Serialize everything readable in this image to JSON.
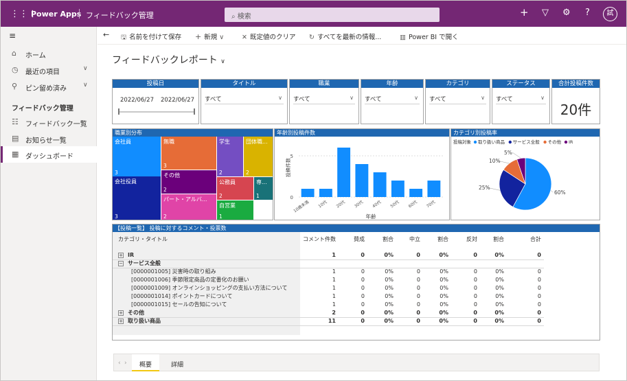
{
  "topbar": {
    "brand": "Power Apps",
    "app_name": "フィードバック管理",
    "search_placeholder": "検索",
    "avatar": "試"
  },
  "sidebar": {
    "items": [
      {
        "label": "ホーム",
        "icon": "home-icon"
      },
      {
        "label": "最近の項目",
        "icon": "clock-icon"
      },
      {
        "label": "ピン留め済み",
        "icon": "pin-icon"
      }
    ],
    "group_label": "フィードバック管理",
    "nav": [
      {
        "label": "フィードバック一覧",
        "icon": "list-icon"
      },
      {
        "label": "お知らせ一覧",
        "icon": "doc-icon"
      },
      {
        "label": "ダッシュボード",
        "icon": "dashboard-icon"
      }
    ]
  },
  "commands": {
    "save_as": "名前を付けて保存",
    "new": "新規",
    "clear_default": "既定値のクリア",
    "refresh_all": "すべてを最新の情報...",
    "open_powerbi": "Power BI で開く"
  },
  "page_title": "フィードバックレポート",
  "filters": {
    "date": {
      "header": "投稿日",
      "from": "2022/06/27",
      "to": "2022/06/27"
    },
    "title": {
      "header": "タイトル",
      "value": "すべて"
    },
    "occupation": {
      "header": "職業",
      "value": "すべて"
    },
    "age": {
      "header": "年齢",
      "value": "すべて"
    },
    "category": {
      "header": "カテゴリ",
      "value": "すべて"
    },
    "status": {
      "header": "ステータス",
      "value": "すべて"
    },
    "total": {
      "header": "合計投稿件数",
      "value": "20件"
    }
  },
  "chart_data": [
    {
      "type": "treemap",
      "title": "職業別分布",
      "items": [
        {
          "label": "会社員",
          "value": 3,
          "color": "#118dff"
        },
        {
          "label": "会社役員",
          "value": 3,
          "color": "#12239e"
        },
        {
          "label": "無職",
          "value": 3,
          "color": "#e66c37"
        },
        {
          "label": "その他",
          "value": 2,
          "color": "#6b007b"
        },
        {
          "label": "パート・アルバ...",
          "value": 2,
          "color": "#e044a7"
        },
        {
          "label": "学生",
          "value": 2,
          "color": "#744ec2"
        },
        {
          "label": "団体職...",
          "value": 2,
          "color": "#d9b300"
        },
        {
          "label": "公務員",
          "value": 2,
          "color": "#d64550"
        },
        {
          "label": "専...",
          "value": 1,
          "color": "#197278"
        },
        {
          "label": "自営業",
          "value": 1,
          "color": "#1aab40"
        }
      ]
    },
    {
      "type": "bar",
      "title": "年齢別投稿件数",
      "xlabel": "年齢",
      "ylabel": "投稿件数",
      "categories": [
        "10歳未満",
        "10代",
        "20代",
        "30代",
        "40代",
        "50代",
        "60代",
        "70代"
      ],
      "values": [
        1,
        1,
        6,
        4,
        3,
        2,
        1,
        2
      ],
      "yticks": [
        0,
        5
      ],
      "ylim": [
        0,
        6.5
      ],
      "color": "#118dff"
    },
    {
      "type": "pie",
      "title": "カテゴリ別投稿率",
      "legend_title": "投稿対象",
      "legend": [
        {
          "label": "取り扱い商品",
          "color": "#118dff"
        },
        {
          "label": "サービス全般",
          "color": "#12239e"
        },
        {
          "label": "その他",
          "color": "#e66c37"
        },
        {
          "label": "IR",
          "color": "#6b007b"
        }
      ],
      "values": [
        11,
        5,
        2,
        1
      ],
      "labels": [
        "60%",
        "25%",
        "10%",
        "5%"
      ]
    }
  ],
  "comment_table": {
    "title": "【投稿一覧】 投稿に対するコメント・投票数",
    "headers": [
      "カテゴリ・タイトル",
      "コメント件数",
      "賛成",
      "割合",
      "中立",
      "割合",
      "反対",
      "割合",
      "合計"
    ],
    "rows": [
      {
        "type": "group",
        "toggle": "+",
        "label": "IR",
        "vals": [
          "1",
          "0",
          "0%",
          "0",
          "0%",
          "0",
          "0%",
          "0"
        ]
      },
      {
        "type": "group",
        "toggle": "−",
        "label": "サービス全般",
        "vals": [
          "",
          "",
          "",
          "",
          "",
          "",
          "",
          ""
        ]
      },
      {
        "type": "item",
        "label": "[0000001005] 災害時の取り組み",
        "vals": [
          "1",
          "0",
          "0%",
          "0",
          "0%",
          "0",
          "0%",
          "0"
        ]
      },
      {
        "type": "item",
        "label": "[0000001006] 季節限定商品の定番化のお願い",
        "vals": [
          "1",
          "0",
          "0%",
          "0",
          "0%",
          "0",
          "0%",
          "0"
        ]
      },
      {
        "type": "item",
        "label": "[0000001009] オンラインショッピングの支払い方法について",
        "vals": [
          "1",
          "0",
          "0%",
          "0",
          "0%",
          "0",
          "0%",
          "0"
        ]
      },
      {
        "type": "item",
        "label": "[0000001014] ポイントカードについて",
        "vals": [
          "1",
          "0",
          "0%",
          "0",
          "0%",
          "0",
          "0%",
          "0"
        ]
      },
      {
        "type": "item",
        "label": "[0000001015] セールの告知について",
        "vals": [
          "1",
          "0",
          "0%",
          "0",
          "0%",
          "0",
          "0%",
          "0"
        ]
      },
      {
        "type": "group",
        "toggle": "+",
        "label": "その他",
        "vals": [
          "2",
          "0",
          "0%",
          "0",
          "0%",
          "0",
          "0%",
          "0"
        ]
      },
      {
        "type": "group",
        "toggle": "+",
        "label": "取り扱い商品",
        "vals": [
          "11",
          "0",
          "0%",
          "0",
          "0%",
          "0",
          "0%",
          "0"
        ]
      }
    ]
  },
  "tabs": [
    "概要",
    "詳細"
  ],
  "tab_nav": {
    "prev": "‹",
    "next": "›"
  }
}
